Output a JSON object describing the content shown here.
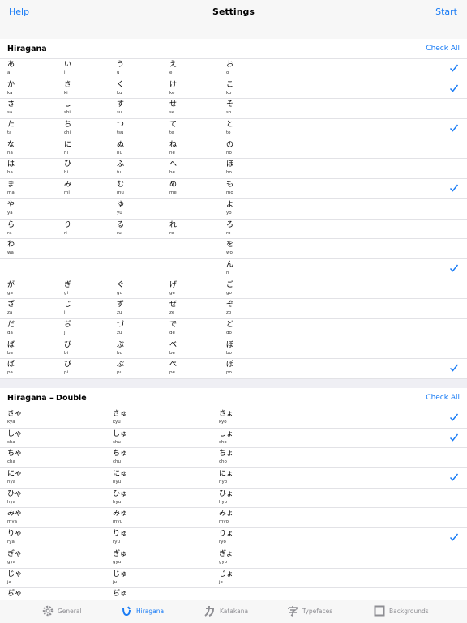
{
  "navbar": {
    "left": "Help",
    "title": "Settings",
    "right": "Start"
  },
  "hiragana": {
    "title": "Hiragana",
    "check_all": "Check All",
    "rows": [
      {
        "cells": [
          [
            "あ",
            "a"
          ],
          [
            "い",
            "i"
          ],
          [
            "う",
            "u"
          ],
          [
            "え",
            "e"
          ],
          [
            "お",
            "o"
          ]
        ],
        "checked": true
      },
      {
        "cells": [
          [
            "か",
            "ka"
          ],
          [
            "き",
            "ki"
          ],
          [
            "く",
            "ku"
          ],
          [
            "け",
            "ke"
          ],
          [
            "こ",
            "ko"
          ]
        ],
        "checked": true
      },
      {
        "cells": [
          [
            "さ",
            "sa"
          ],
          [
            "し",
            "shi"
          ],
          [
            "す",
            "su"
          ],
          [
            "せ",
            "se"
          ],
          [
            "そ",
            "so"
          ]
        ],
        "checked": false
      },
      {
        "cells": [
          [
            "た",
            "ta"
          ],
          [
            "ち",
            "chi"
          ],
          [
            "つ",
            "tsu"
          ],
          [
            "て",
            "te"
          ],
          [
            "と",
            "to"
          ]
        ],
        "checked": true
      },
      {
        "cells": [
          [
            "な",
            "na"
          ],
          [
            "に",
            "ni"
          ],
          [
            "ぬ",
            "nu"
          ],
          [
            "ね",
            "ne"
          ],
          [
            "の",
            "no"
          ]
        ],
        "checked": false
      },
      {
        "cells": [
          [
            "は",
            "ha"
          ],
          [
            "ひ",
            "hi"
          ],
          [
            "ふ",
            "fu"
          ],
          [
            "へ",
            "he"
          ],
          [
            "ほ",
            "ho"
          ]
        ],
        "checked": false
      },
      {
        "cells": [
          [
            "ま",
            "ma"
          ],
          [
            "み",
            "mi"
          ],
          [
            "む",
            "mu"
          ],
          [
            "め",
            "me"
          ],
          [
            "も",
            "mo"
          ]
        ],
        "checked": true
      },
      {
        "cells": [
          [
            "や",
            "ya"
          ],
          null,
          [
            "ゆ",
            "yu"
          ],
          null,
          [
            "よ",
            "yo"
          ]
        ],
        "checked": false
      },
      {
        "cells": [
          [
            "ら",
            "ra"
          ],
          [
            "り",
            "ri"
          ],
          [
            "る",
            "ru"
          ],
          [
            "れ",
            "re"
          ],
          [
            "ろ",
            "ro"
          ]
        ],
        "checked": false
      },
      {
        "cells": [
          [
            "わ",
            "wa"
          ],
          null,
          null,
          null,
          [
            "を",
            "wo"
          ]
        ],
        "checked": false
      },
      {
        "cells": [
          null,
          null,
          null,
          null,
          [
            "ん",
            "n"
          ]
        ],
        "checked": true
      },
      {
        "cells": [
          [
            "が",
            "ga"
          ],
          [
            "ぎ",
            "gi"
          ],
          [
            "ぐ",
            "gu"
          ],
          [
            "げ",
            "ge"
          ],
          [
            "ご",
            "go"
          ]
        ],
        "checked": false
      },
      {
        "cells": [
          [
            "ざ",
            "za"
          ],
          [
            "じ",
            "ji"
          ],
          [
            "ず",
            "zu"
          ],
          [
            "ぜ",
            "ze"
          ],
          [
            "ぞ",
            "zo"
          ]
        ],
        "checked": false
      },
      {
        "cells": [
          [
            "だ",
            "da"
          ],
          [
            "ぢ",
            "ji"
          ],
          [
            "づ",
            "zu"
          ],
          [
            "で",
            "de"
          ],
          [
            "ど",
            "do"
          ]
        ],
        "checked": false
      },
      {
        "cells": [
          [
            "ば",
            "ba"
          ],
          [
            "び",
            "bi"
          ],
          [
            "ぶ",
            "bu"
          ],
          [
            "べ",
            "be"
          ],
          [
            "ぼ",
            "bo"
          ]
        ],
        "checked": false
      },
      {
        "cells": [
          [
            "ぱ",
            "pa"
          ],
          [
            "ぴ",
            "pi"
          ],
          [
            "ぷ",
            "pu"
          ],
          [
            "ぺ",
            "pe"
          ],
          [
            "ぽ",
            "po"
          ]
        ],
        "checked": true
      }
    ]
  },
  "hiragana_double": {
    "title": "Hiragana – Double",
    "check_all": "Check All",
    "rows": [
      {
        "cells": [
          [
            "きゃ",
            "kya"
          ],
          [
            "きゅ",
            "kyu"
          ],
          [
            "きょ",
            "kyo"
          ]
        ],
        "checked": true
      },
      {
        "cells": [
          [
            "しゃ",
            "sha"
          ],
          [
            "しゅ",
            "shu"
          ],
          [
            "しょ",
            "sho"
          ]
        ],
        "checked": true
      },
      {
        "cells": [
          [
            "ちゃ",
            "cha"
          ],
          [
            "ちゅ",
            "chu"
          ],
          [
            "ちょ",
            "cho"
          ]
        ],
        "checked": false
      },
      {
        "cells": [
          [
            "にゃ",
            "nya"
          ],
          [
            "にゅ",
            "nyu"
          ],
          [
            "にょ",
            "nyo"
          ]
        ],
        "checked": true
      },
      {
        "cells": [
          [
            "ひゃ",
            "hya"
          ],
          [
            "ひゅ",
            "hyu"
          ],
          [
            "ひょ",
            "hyo"
          ]
        ],
        "checked": false
      },
      {
        "cells": [
          [
            "みゃ",
            "mya"
          ],
          [
            "みゅ",
            "myu"
          ],
          [
            "みょ",
            "myo"
          ]
        ],
        "checked": false
      },
      {
        "cells": [
          [
            "りゃ",
            "rya"
          ],
          [
            "りゅ",
            "ryu"
          ],
          [
            "りょ",
            "ryo"
          ]
        ],
        "checked": true
      },
      {
        "cells": [
          [
            "ぎゃ",
            "gya"
          ],
          [
            "ぎゅ",
            "gyu"
          ],
          [
            "ぎょ",
            "gyo"
          ]
        ],
        "checked": false
      },
      {
        "cells": [
          [
            "じゃ",
            "ja"
          ],
          [
            "じゅ",
            "ju"
          ],
          [
            "じょ",
            "jo"
          ]
        ],
        "checked": false
      },
      {
        "cells": [
          [
            "ぢゃ",
            ""
          ],
          [
            "ぢゅ",
            ""
          ],
          null
        ],
        "checked": false
      }
    ]
  },
  "tabs": [
    {
      "label": "General",
      "icon": "gear-icon",
      "active": false
    },
    {
      "label": "Hiragana",
      "icon": "hiragana-icon",
      "active": true
    },
    {
      "label": "Katakana",
      "icon": "katakana-icon",
      "active": false
    },
    {
      "label": "Typefaces",
      "icon": "typeface-icon",
      "active": false
    },
    {
      "label": "Backgrounds",
      "icon": "background-icon",
      "active": false
    }
  ],
  "colors": {
    "accent": "#1a7cf5",
    "inactive": "#8e8e93"
  }
}
